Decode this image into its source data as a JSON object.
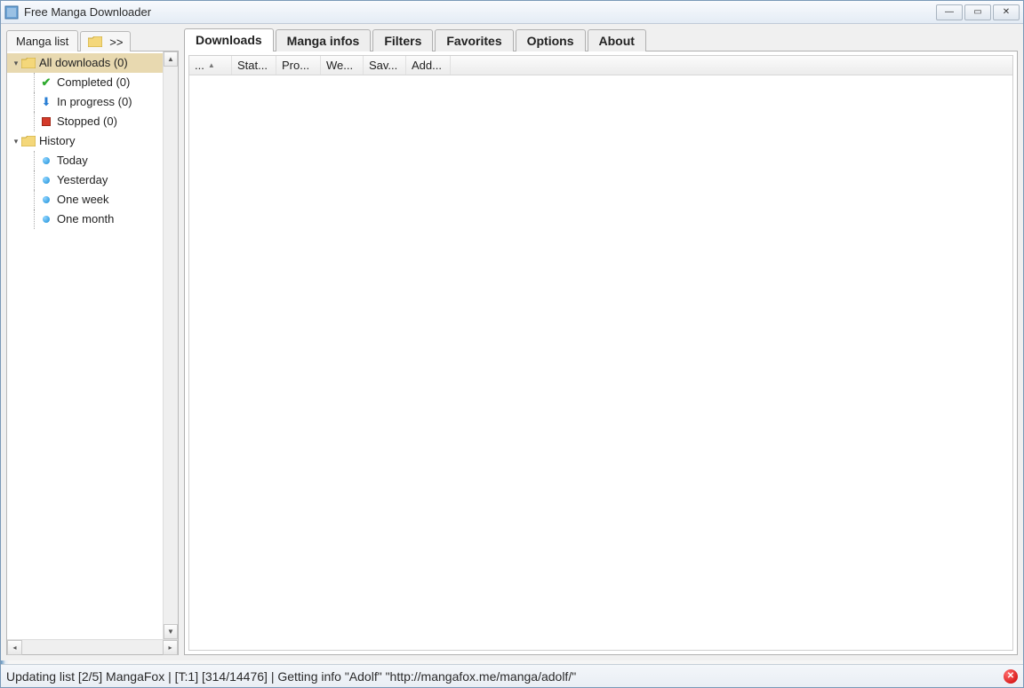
{
  "window": {
    "title": "Free Manga Downloader"
  },
  "sidebar": {
    "tabs": {
      "list_label": "Manga list",
      "folder_label": ">>"
    },
    "tree": {
      "all_downloads": "All downloads (0)",
      "completed": "Completed (0)",
      "in_progress": "In progress (0)",
      "stopped": "Stopped (0)",
      "history": "History",
      "today": "Today",
      "yesterday": "Yesterday",
      "one_week": "One week",
      "one_month": "One month"
    }
  },
  "main": {
    "tabs": {
      "downloads": "Downloads",
      "manga_infos": "Manga infos",
      "filters": "Filters",
      "favorites": "Favorites",
      "options": "Options",
      "about": "About"
    },
    "columns": {
      "c0": "...",
      "c1": "Stat...",
      "c2": "Pro...",
      "c3": "We...",
      "c4": "Sav...",
      "c5": "Add..."
    }
  },
  "status": {
    "text": "Updating list [2/5] MangaFox | [T:1] [314/14476] | Getting info \"Adolf\" \"http://mangafox.me/manga/adolf/\""
  }
}
